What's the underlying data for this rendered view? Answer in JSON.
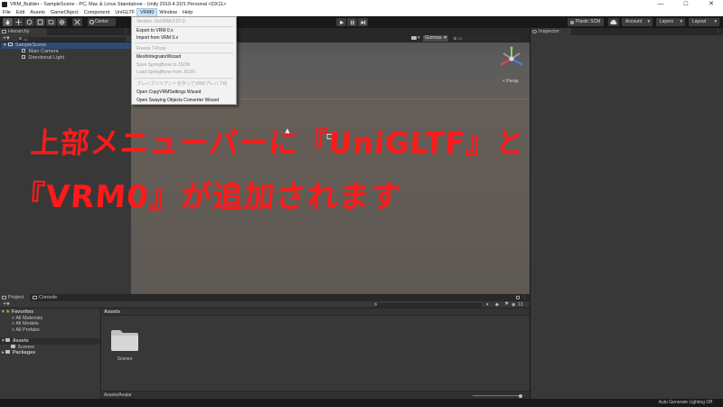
{
  "window": {
    "title": "VRM_Builder - SampleScene - PC, Mac & Linux Standalone - Unity 2019.4.31f1 Personal <DX11>",
    "controls": {
      "minimize": "—",
      "maximize": "☐",
      "close": "✕"
    }
  },
  "menubar": {
    "items": [
      "File",
      "Edit",
      "Assets",
      "GameObject",
      "Component",
      "UniGLTF",
      "VRM0",
      "Window",
      "Help"
    ],
    "active": "VRM0"
  },
  "toolbar": {
    "pivot_label": "Center",
    "plastic_label": "Plastic SCM",
    "account_label": "Account",
    "layers_label": "Layers",
    "layout_label": "Layout"
  },
  "vrm_menu": {
    "items": [
      {
        "label": "Version: UniVRM-0.97.0",
        "enabled": false
      },
      {
        "label": "Export to VRM 0.x",
        "enabled": true
      },
      {
        "label": "Import from VRM 0.x",
        "enabled": true
      },
      {
        "label": "Freeze T-Pose",
        "enabled": false
      },
      {
        "label": "MeshIntegratorWizard",
        "enabled": true
      },
      {
        "label": "Save SpringBone to JSON",
        "enabled": false
      },
      {
        "label": "Load SpringBone from JSON",
        "enabled": false
      },
      {
        "label": "プレハブバリアントを作ってVRMプレハブ化",
        "enabled": false
      },
      {
        "label": "Open CopyVRMSettings Wizard",
        "enabled": true
      },
      {
        "label": "Open Swaying Objects Converter Wizard",
        "enabled": true
      }
    ]
  },
  "hierarchy": {
    "tab_label": "Hierarchy",
    "search_placeholder": "All",
    "scene": "SampleScene",
    "objects": [
      "Main Camera",
      "Directional Light"
    ]
  },
  "scene_view": {
    "gizmos_label": "Gizmos",
    "search_placeholder": "All",
    "projection_label": "< Persp"
  },
  "inspector": {
    "tab_label": "Inspector"
  },
  "project": {
    "tabs": [
      "Project",
      "Console"
    ],
    "count": "13",
    "favorites_label": "Favorites",
    "favorites": [
      "All Materials",
      "All Models",
      "All Prefabs"
    ],
    "tree": {
      "assets": "Assets",
      "scenes": "Scenes",
      "packages": "Packages"
    },
    "breadcrumb": "Assets",
    "folder_label": "Scenes",
    "footer_path": "Assets/Avatar"
  },
  "status": {
    "right": "Auto Generate Lighting Off"
  },
  "annotation": {
    "line1": "上部メニューバーに『UniGLTF』と",
    "line2": "『VRM0』が追加されます",
    "color": "#ff1a1a"
  },
  "colors": {
    "editor_bg": "#191919",
    "panel_bg": "#383838",
    "tab_bar": "#282828",
    "menu_bg": "#f2f2f2",
    "selection": "#3e5f96"
  }
}
